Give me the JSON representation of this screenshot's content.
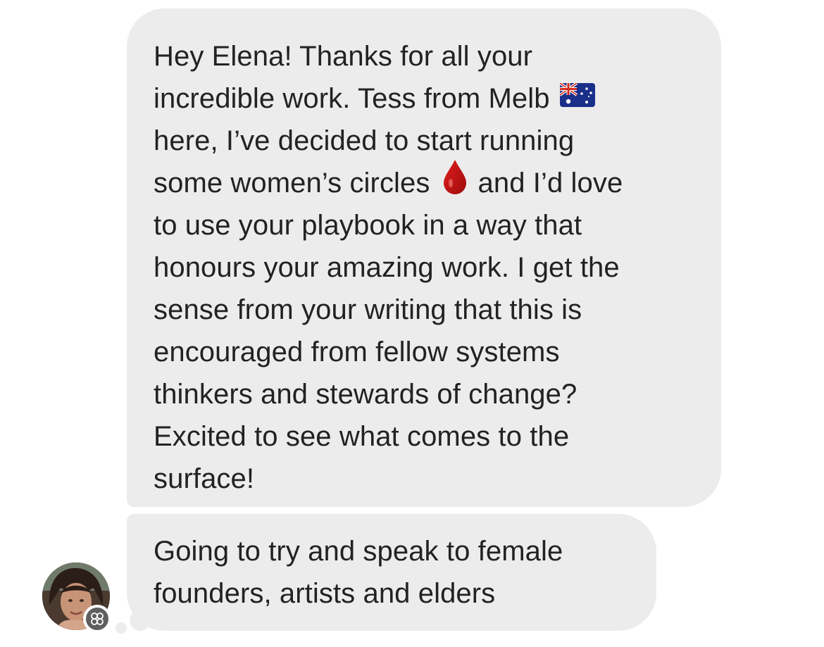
{
  "thread": {
    "messages": [
      {
        "lines": [
          {
            "text": "Hey Elena! Thanks for all your"
          },
          {
            "text": "incredible work. Tess from Melb",
            "emoji_after": "australia-flag-icon"
          },
          {
            "text": "here, I’ve decided to start running"
          },
          {
            "text_before": "some women’s circles",
            "emoji": "drop-of-blood-icon",
            "text_after": "and I’d love"
          },
          {
            "text": "to use your playbook in a way that"
          },
          {
            "text": "honours your amazing work. I get the"
          },
          {
            "text": "sense from your writing that this is"
          },
          {
            "text": "encouraged from fellow systems"
          },
          {
            "text": "thinkers and stewards of change?"
          },
          {
            "text": "Excited to see what comes to the"
          },
          {
            "text": "surface!"
          }
        ]
      },
      {
        "lines": [
          {
            "text": "Going to try and speak to female"
          },
          {
            "text": "founders, artists and elders"
          }
        ]
      }
    ],
    "sender": {
      "avatar_icon": "avatar",
      "badge_icon": "flower-badge-icon"
    }
  },
  "colors": {
    "bubble": "#ececed",
    "text": "#222222",
    "background": "#ffffff",
    "badge": "#5f5f5f"
  }
}
